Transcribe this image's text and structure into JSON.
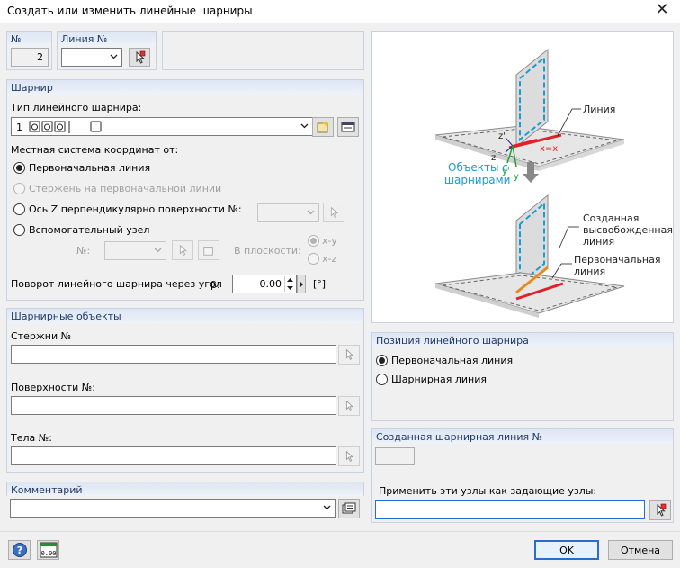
{
  "window": {
    "title": "Создать или изменить линейные шарниры",
    "close_glyph": "✕"
  },
  "number_group": {
    "header": "№",
    "value": "2"
  },
  "line_group": {
    "header": "Линия №",
    "value": ""
  },
  "hinge": {
    "header": "Шарнир",
    "type_label": "Тип линейного шарнира:",
    "type_value_number": "1",
    "coord_label": "Местная система координат от:",
    "options": [
      {
        "label": "Первоначальная линия",
        "selected": true,
        "enabled": true
      },
      {
        "label": "Стержень на первоначальной линии",
        "selected": false,
        "enabled": false
      },
      {
        "label": "Ось Z перпендикулярно поверхности №:",
        "selected": false,
        "enabled": true
      },
      {
        "label": "Вспомогательный узел",
        "selected": false,
        "enabled": true
      }
    ],
    "node_label": "№:",
    "in_plane_label": "В плоскости:",
    "plane_options": [
      "x-y",
      "x-z"
    ],
    "rotation_label": "Поворот линейного шарнира через угол",
    "rotation_symbol": "β:",
    "rotation_value": "0.00",
    "rotation_unit": "[°]"
  },
  "hinged_objects": {
    "header": "Шарнирные объекты",
    "members_label": "Стержни №",
    "surfaces_label": "Поверхности №:",
    "solids_label": "Тела №:"
  },
  "comment": {
    "header": "Комментарий",
    "value": ""
  },
  "diagram": {
    "line_label": "Линия",
    "axis_z_prime": "z'",
    "axis_z": "z",
    "axis_x_eq": "x=x'",
    "axis_y_prime": "y'",
    "axis_y": "y",
    "objects_label_1": "Объекты с",
    "objects_label_2": "шарнирами",
    "created_label_1": "Созданная",
    "created_label_2": "высвобожденная",
    "created_label_3": "линия",
    "original_label_1": "Первоначальная",
    "original_label_2": "линия",
    "accent_color": "#1a9ad6",
    "red_color": "#e0202a",
    "orange_color": "#e88a1a"
  },
  "position": {
    "header": "Позиция линейного шарнира",
    "options": [
      {
        "label": "Первоначальная линия",
        "selected": true
      },
      {
        "label": "Шарнирная линия",
        "selected": false
      }
    ]
  },
  "created_line": {
    "header": "Созданная шарнирная линия №",
    "value": "",
    "apply_label": "Применить эти узлы как задающие узлы:",
    "apply_value": ""
  },
  "footer": {
    "ok": "OK",
    "cancel": "Отмена",
    "units_icon_text": "0.00"
  }
}
